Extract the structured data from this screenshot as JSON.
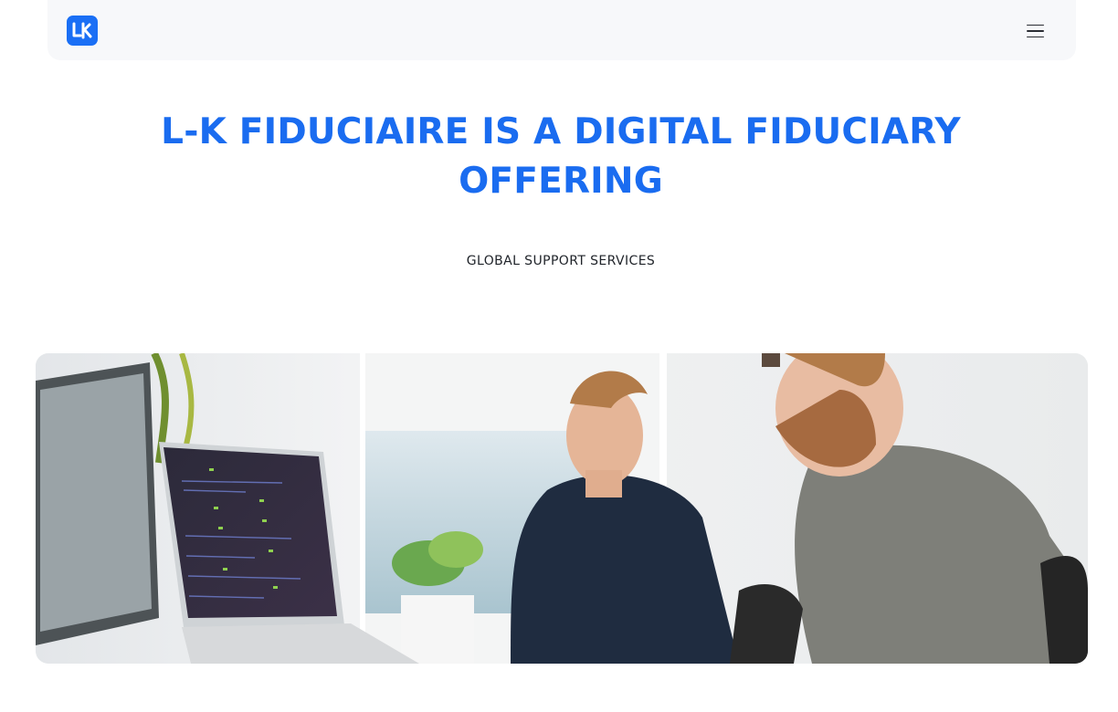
{
  "nav": {
    "logo_text": "LK",
    "logo_icon": "lk-logo-icon",
    "menu_icon": "hamburger-menu-icon"
  },
  "hero": {
    "title": "L-K FIDUCIAIRE IS A DIGITAL FIDUCIARY OFFERING",
    "subtitle": "GLOBAL SUPPORT SERVICES"
  },
  "colors": {
    "brand_blue": "#1a6cf0",
    "nav_bg": "#f7f8fa",
    "text_dark": "#1f2329"
  },
  "image": {
    "subject": "two-men-working-on-laptops-photo"
  }
}
